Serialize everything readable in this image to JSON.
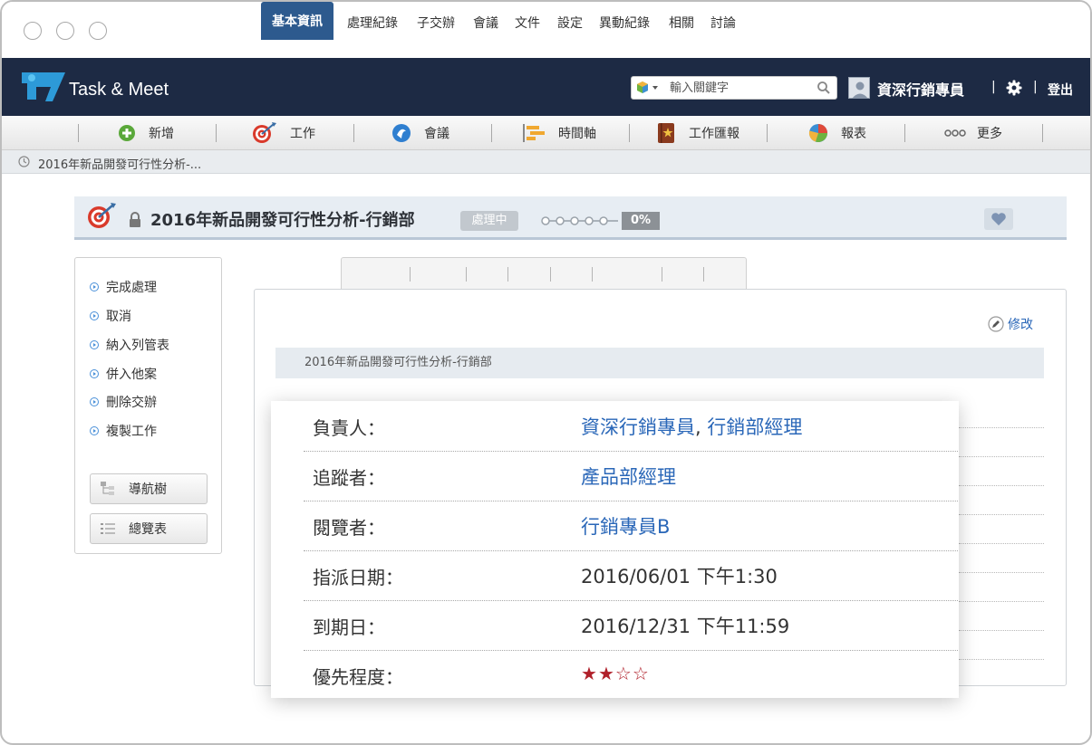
{
  "app": {
    "name": "Task & Meet"
  },
  "header": {
    "search_placeholder": "輸入關鍵字",
    "user_name": "資深行銷專員",
    "separator": "|",
    "logout_label": "登出"
  },
  "nav": {
    "items": [
      {
        "label": "新增",
        "icon": "add-icon"
      },
      {
        "label": "工作",
        "icon": "target-icon"
      },
      {
        "label": "會議",
        "icon": "meeting-icon"
      },
      {
        "label": "時間軸",
        "icon": "timeline-icon"
      },
      {
        "label": "工作匯報",
        "icon": "report-book-icon"
      },
      {
        "label": "報表",
        "icon": "pie-chart-icon"
      },
      {
        "label": "更多",
        "icon": "more-icon"
      }
    ]
  },
  "breadcrumb": {
    "text": "2016年新品開發可行性分析-..."
  },
  "task": {
    "title": "2016年新品開發可行性分析-行銷部",
    "status": "處理中",
    "progress_percent": 0,
    "progress_label": "0%"
  },
  "actions": {
    "items": [
      "完成處理",
      "取消",
      "納入列管表",
      "併入他案",
      "刪除交辦",
      "複製工作"
    ],
    "nav_tree_label": "導航樹",
    "overview_label": "總覽表"
  },
  "tabs": [
    "基本資訊",
    "處理紀錄",
    "子交辦",
    "會議",
    "文件",
    "設定",
    "異動紀錄",
    "相關",
    "討論"
  ],
  "content": {
    "edit_label": "修改",
    "subject": "2016年新品開發可行性分析-行銷部"
  },
  "details": {
    "owner": {
      "label": "負責人：",
      "values": [
        "資深行銷專員",
        "行銷部經理"
      ],
      "separator": ","
    },
    "follower": {
      "label": "追蹤者：",
      "value": "產品部經理"
    },
    "viewer": {
      "label": "閱覽者：",
      "value": "行銷專員B"
    },
    "assigned_date": {
      "label": "指派日期：",
      "value": "2016/06/01 下午1:30"
    },
    "due_date": {
      "label": "到期日：",
      "value": "2016/12/31 下午11:59"
    },
    "priority": {
      "label": "優先程度：",
      "stars_filled": 2,
      "stars_total": 4
    }
  },
  "colors": {
    "header_bg": "#1d2a44",
    "tab_active": "#2d5a8e",
    "link": "#2a67b8",
    "star": "#b0202a"
  }
}
